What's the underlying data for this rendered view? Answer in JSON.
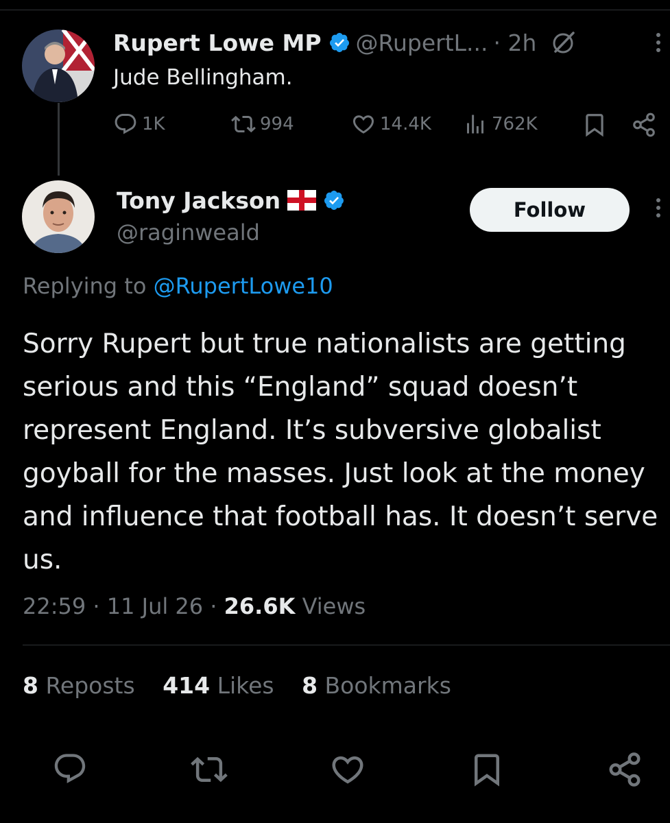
{
  "parent_tweet": {
    "display_name": "Rupert Lowe MP",
    "handle": "@RupertL...",
    "time": "· 2h",
    "text": "Jude Bellingham.",
    "replies": "1K",
    "reposts": "994",
    "likes": "14.4K",
    "views": "762K"
  },
  "main_tweet": {
    "display_name": "Tony Jackson",
    "handle": "@raginweald",
    "follow_label": "Follow",
    "replying_prefix": "Replying to ",
    "replying_handle": "@RupertLowe10",
    "text": "Sorry Rupert but true nationalists are getting serious and this “England” squad doesn’t represent England. It’s subversive globalist goyball for the masses. Just look at the money and influence that football has. It doesn’t serve us.",
    "time": "22:59",
    "date": "11 Jul 26",
    "sep": "·",
    "views_count": "26.6K",
    "views_label": "Views",
    "reposts_count": "8",
    "reposts_label": "Reposts",
    "likes_count": "414",
    "likes_label": "Likes",
    "bookmarks_count": "8",
    "bookmarks_label": "Bookmarks"
  },
  "colors": {
    "background": "#000000",
    "text": "#e7e9ea",
    "muted": "#71767b",
    "link": "#1d9bf0",
    "verified": "#1d9bf0",
    "divider": "#2f3336"
  },
  "icons": [
    "reply-icon",
    "repost-icon",
    "like-icon",
    "views-icon",
    "bookmark-icon",
    "share-icon",
    "verified-badge-icon",
    "grok-icon",
    "more-icon",
    "england-flag-icon"
  ]
}
